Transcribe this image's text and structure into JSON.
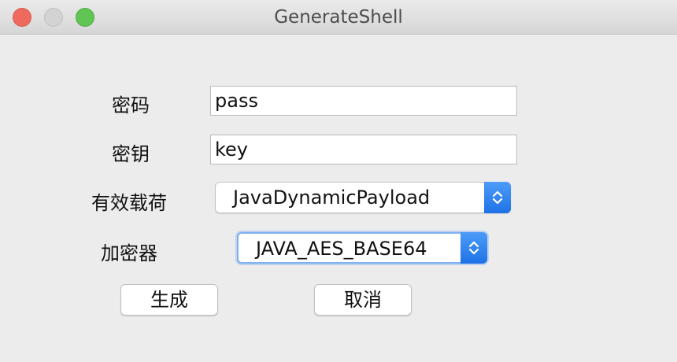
{
  "window": {
    "title": "GenerateShell"
  },
  "form": {
    "password_label": "密码",
    "password_value": "pass",
    "key_label": "密钥",
    "key_value": "key",
    "payload_label": "有效载荷",
    "payload_selected": "JavaDynamicPayload",
    "encoder_label": "加密器",
    "encoder_selected": "JAVA_AES_BASE64"
  },
  "buttons": {
    "generate_label": "生成",
    "cancel_label": "取消"
  },
  "colors": {
    "accent": "#1e72e6",
    "focus_ring": "#7fb0f0",
    "close": "#ee6a5f",
    "maximize": "#61c554"
  },
  "icons": {
    "combo_arrows": "up-down-chevron-icon"
  }
}
